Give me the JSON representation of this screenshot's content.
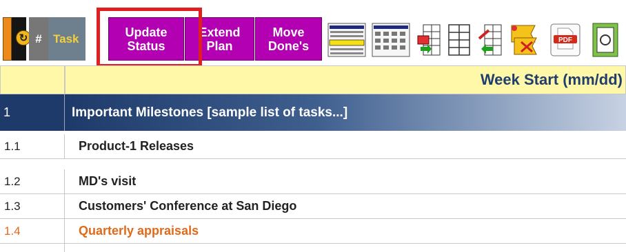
{
  "toolbar": {
    "hash_label": "#",
    "task_label": "Task",
    "buttons": [
      {
        "label": "Update\nStatus"
      },
      {
        "label": "Extend\nPlan"
      },
      {
        "label": "Move\nDone's"
      }
    ],
    "pdf_label": "PDF"
  },
  "sheet": {
    "header_title": "Week Start (mm/dd)",
    "section": {
      "number": "1",
      "title": "Important Milestones [sample list of tasks...]"
    },
    "rows": [
      {
        "number": "1.1",
        "title": "Product-1 Releases"
      },
      {
        "number": "1.2",
        "title": "MD's visit"
      },
      {
        "number": "1.3",
        "title": "Customers' Conference at San Diego"
      },
      {
        "number": "1.4",
        "title": "Quarterly appraisals"
      }
    ]
  },
  "colors": {
    "accent_purple": "#b200b2",
    "highlight_red": "#e02020",
    "orange_text": "#e06a1a"
  }
}
